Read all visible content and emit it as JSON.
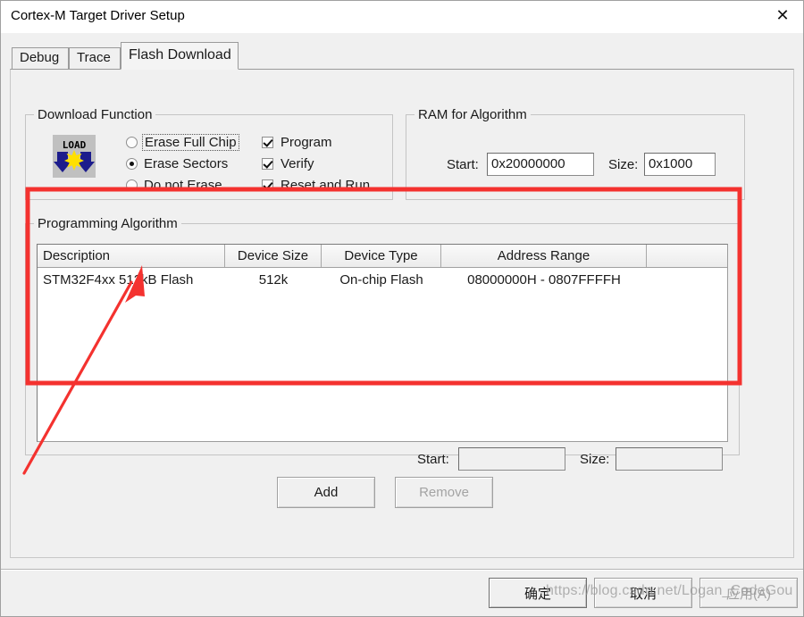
{
  "window": {
    "title": "Cortex-M Target Driver Setup",
    "close_icon": "close-icon"
  },
  "tabs": [
    {
      "label": "Debug",
      "active": false
    },
    {
      "label": "Trace",
      "active": false
    },
    {
      "label": "Flash Download",
      "active": true
    }
  ],
  "download_function": {
    "title": "Download Function",
    "icon": "load-icon",
    "icon_text": "LOAD",
    "radios": [
      {
        "label": "Erase Full Chip",
        "checked": false,
        "focused": true
      },
      {
        "label": "Erase Sectors",
        "checked": true,
        "focused": false
      },
      {
        "label": "Do not Erase",
        "checked": false,
        "focused": false
      }
    ],
    "checkboxes": [
      {
        "label": "Program",
        "checked": true
      },
      {
        "label": "Verify",
        "checked": true
      },
      {
        "label": "Reset and Run",
        "checked": true
      }
    ]
  },
  "ram_for_algorithm": {
    "title": "RAM for Algorithm",
    "start_label": "Start:",
    "start_value": "0x20000000",
    "size_label": "Size:",
    "size_value": "0x1000"
  },
  "programming_algorithm": {
    "title": "Programming Algorithm",
    "columns": [
      "Description",
      "Device Size",
      "Device Type",
      "Address Range",
      ""
    ],
    "rows": [
      {
        "description": "STM32F4xx 512kB Flash",
        "device_size": "512k",
        "device_type": "On-chip Flash",
        "address_range": "08000000H - 0807FFFFH",
        "extra": ""
      }
    ],
    "start_label": "Start:",
    "start_value": "",
    "size_label": "Size:",
    "size_value": "",
    "add_label": "Add",
    "remove_label": "Remove",
    "remove_disabled": true
  },
  "footer": {
    "ok_label": "确定",
    "cancel_label": "取消",
    "apply_label": "应用(A)",
    "apply_disabled": true
  },
  "annotations": {
    "highlight_color": "#f4322f",
    "arrow_color": "#f4322f",
    "watermark": "https://blog.csdn.net/Logan_CodeGou"
  }
}
